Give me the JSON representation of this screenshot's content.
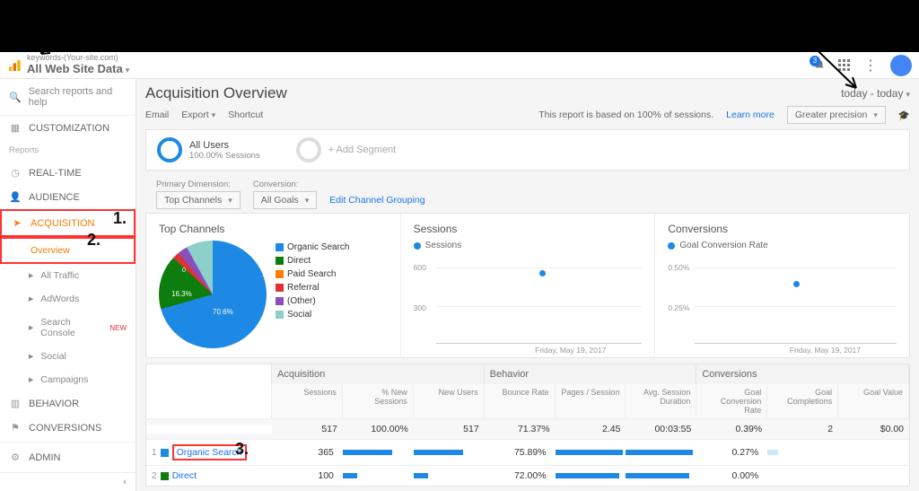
{
  "header": {
    "property_top": "keywords-(Your-site.com)",
    "property_name": "All Web Site Data",
    "notifications": "3"
  },
  "sidebar": {
    "search_placeholder": "Search reports and help",
    "customization": "CUSTOMIZATION",
    "section_reports": "Reports",
    "realtime": "REAL-TIME",
    "audience": "AUDIENCE",
    "acquisition": "ACQUISITION",
    "overview": "Overview",
    "all_traffic": "All Traffic",
    "adwords": "AdWords",
    "search_console": "Search Console",
    "new_badge": "NEW",
    "social": "Social",
    "campaigns": "Campaigns",
    "behavior": "BEHAVIOR",
    "conversions": "CONVERSIONS",
    "admin": "ADMIN"
  },
  "page": {
    "title": "Acquisition Overview",
    "date_range": "today - today",
    "actions": {
      "email": "Email",
      "export": "Export",
      "shortcut": "Shortcut"
    },
    "report_note": "This report is based on 100% of sessions.",
    "learn_more": "Learn more",
    "precision": "Greater precision"
  },
  "segments": {
    "all_users": "All Users",
    "all_users_sub": "100.00% Sessions",
    "add": "+ Add Segment"
  },
  "dims": {
    "primary_label": "Primary Dimension:",
    "primary_value": "Top Channels",
    "conv_label": "Conversion:",
    "conv_value": "All Goals",
    "edit": "Edit Channel Grouping"
  },
  "chart_data": [
    {
      "type": "pie",
      "title": "Top Channels",
      "series": [
        {
          "name": "Organic Search",
          "value": 70.6,
          "color": "#1e88e5"
        },
        {
          "name": "Direct",
          "value": 16.3,
          "color": "#0d7d0d"
        },
        {
          "name": "Paid Search",
          "value": 0,
          "color": "#ff7d00"
        },
        {
          "name": "Referral",
          "value": 2.1,
          "color": "#d33"
        },
        {
          "name": "(Other)",
          "value": 3.0,
          "color": "#8a4fbd"
        },
        {
          "name": "Social",
          "value": 8.0,
          "color": "#8cd0c9"
        }
      ]
    },
    {
      "type": "line",
      "title": "Sessions",
      "legend": "Sessions",
      "x": [
        "Friday, May 19, 2017"
      ],
      "values": [
        517
      ],
      "yticks": [
        "300",
        "600"
      ],
      "color": "#1e88e5"
    },
    {
      "type": "line",
      "title": "Conversions",
      "legend": "Goal Conversion Rate",
      "x": [
        "Friday, May 19, 2017"
      ],
      "values": [
        0.39
      ],
      "yticks": [
        "0.25%",
        "0.50%"
      ],
      "color": "#1e88e5"
    }
  ],
  "table": {
    "groups": [
      "Acquisition",
      "Behavior",
      "Conversions"
    ],
    "columns": [
      "Sessions",
      "% New Sessions",
      "New Users",
      "Bounce Rate",
      "Pages / Session",
      "Avg. Session Duration",
      "Goal Conversion Rate",
      "Goal Completions",
      "Goal Value"
    ],
    "totals": [
      "517",
      "100.00%",
      "517",
      "71.37%",
      "2.45",
      "00:03:55",
      "0.39%",
      "2",
      "$0.00"
    ],
    "rows": [
      {
        "n": "1",
        "name": "Organic Search",
        "color": "#1e88e5",
        "sessions": "365",
        "bounce": "75.89%",
        "gcr": "0.27%"
      },
      {
        "n": "2",
        "name": "Direct",
        "color": "#0d7d0d",
        "sessions": "100",
        "bounce": "72.00%",
        "gcr": "0.00%"
      }
    ]
  },
  "ann": {
    "a1": "1.",
    "a2": "2.",
    "a3": "3."
  }
}
